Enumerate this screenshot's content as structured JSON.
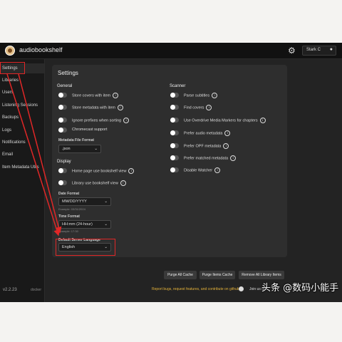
{
  "header": {
    "app_title": "audiobookshelf",
    "user_name": "Stark C",
    "settings_icon": "gear-icon",
    "user_icon": "person-icon"
  },
  "sidebar": {
    "items": [
      {
        "label": "Settings",
        "active": true
      },
      {
        "label": "Libraries"
      },
      {
        "label": "Users"
      },
      {
        "label": "Listening Sessions"
      },
      {
        "label": "Backups"
      },
      {
        "label": "Logs"
      },
      {
        "label": "Notifications"
      },
      {
        "label": "Email"
      },
      {
        "label": "Item Metadata Utils"
      }
    ],
    "version": "v2.2.23",
    "docker": "docker"
  },
  "main": {
    "title": "Settings",
    "general": {
      "heading": "General",
      "items": [
        {
          "label": "Store covers with item",
          "info": true
        },
        {
          "label": "Store metadata with item",
          "info": true
        },
        {
          "label": "Ignore prefixes when sorting",
          "info": true
        },
        {
          "label": "Chromecast support",
          "info": false
        }
      ],
      "metadata_format_label": "Metadata File Format",
      "metadata_format_value": ".json"
    },
    "display": {
      "heading": "Display",
      "items": [
        {
          "label": "Home page use bookshelf view",
          "info": true
        },
        {
          "label": "Library use bookshelf view",
          "info": true
        }
      ],
      "date_format_label": "Date Format",
      "date_format_value": "MM/DD/YYYY",
      "date_example": "Example: 03/31/2024",
      "time_format_label": "Time Format",
      "time_format_value": "HH:mm (24-hour)",
      "time_example": "Example: 17:30",
      "language_label": "Default Server Language",
      "language_value": "English"
    },
    "scanner": {
      "heading": "Scanner",
      "items": [
        {
          "label": "Parse subtitles",
          "info": true
        },
        {
          "label": "Find covers",
          "info": true
        },
        {
          "label": "Use Overdrive Media Markers for chapters",
          "info": true
        },
        {
          "label": "Prefer audio metadata",
          "info": true
        },
        {
          "label": "Prefer OPF metadata",
          "info": true
        },
        {
          "label": "Prefer matched metadata",
          "info": true
        },
        {
          "label": "Disable Watcher",
          "info": true
        }
      ]
    },
    "buttons": {
      "purge_all": "Purge All Cache",
      "purge_items": "Purge Items Cache",
      "remove_all": "Remove All Library Items"
    },
    "footer": {
      "text": "Report bugs, request features, and contribute on github",
      "join": "Join us on"
    }
  },
  "watermark": "头条 @数码小能手",
  "colors": {
    "accent_red": "#e02727",
    "footer_gold": "#e4b23a"
  }
}
